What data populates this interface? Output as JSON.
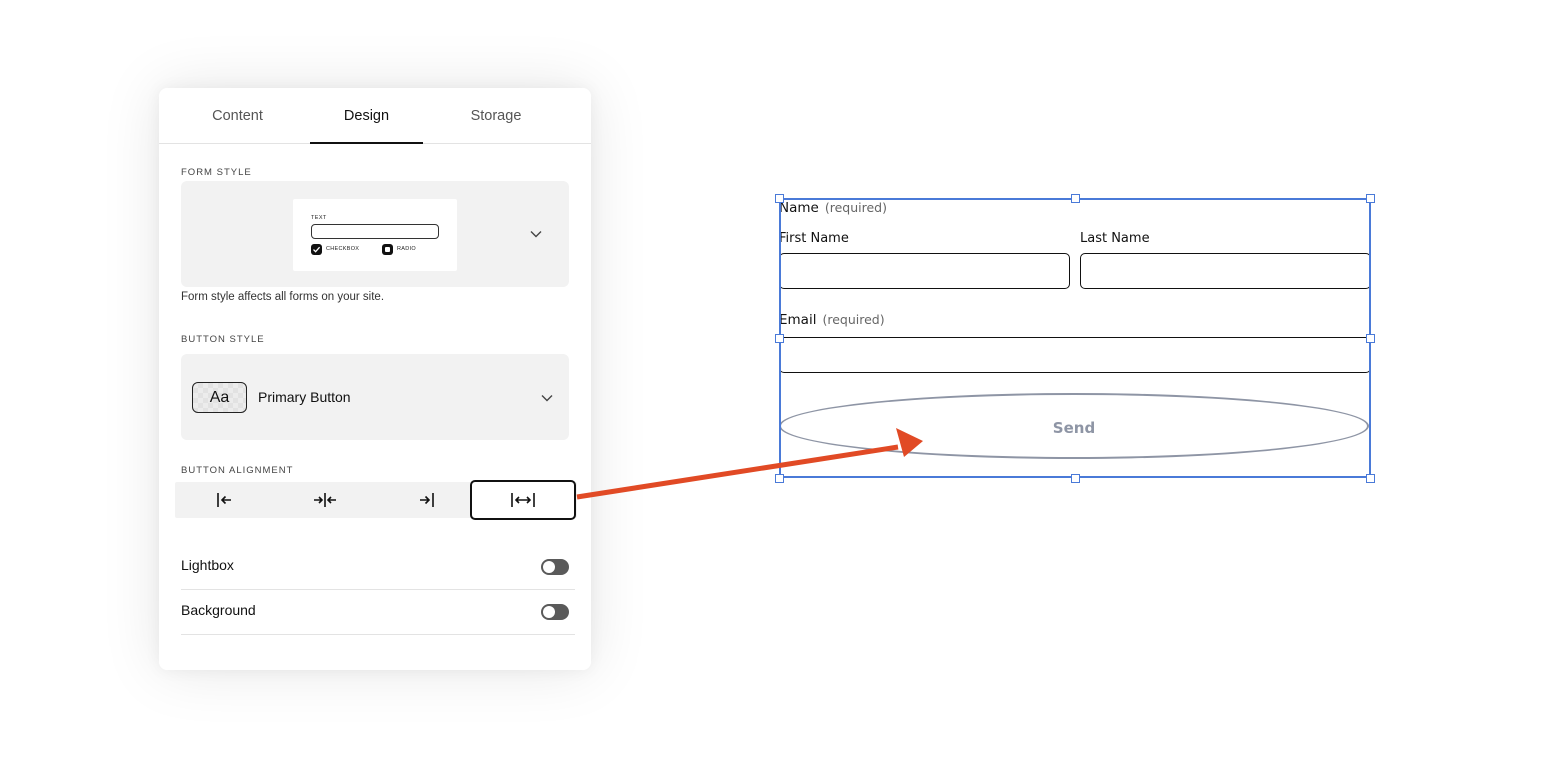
{
  "tabs": [
    {
      "label": "Content",
      "active": false
    },
    {
      "label": "Design",
      "active": true
    },
    {
      "label": "Storage",
      "active": false
    }
  ],
  "form_style": {
    "section_label": "FORM STYLE",
    "preview": {
      "text_label": "TEXT",
      "checkbox_label": "CHECKBOX",
      "radio_label": "RADIO"
    },
    "helper": "Form style affects all forms on your site."
  },
  "button_style": {
    "section_label": "BUTTON STYLE",
    "swatch_text": "Aa",
    "value": "Primary Button"
  },
  "button_alignment": {
    "section_label": "BUTTON ALIGNMENT",
    "options": [
      "left",
      "center",
      "right",
      "full-width"
    ],
    "selected": "full-width"
  },
  "toggles": [
    {
      "label": "Lightbox",
      "on": false
    },
    {
      "label": "Background",
      "on": false
    }
  ],
  "form_preview": {
    "name_label": "Name",
    "name_required": "(required)",
    "first_name_label": "First Name",
    "last_name_label": "Last Name",
    "email_label": "Email",
    "email_required": "(required)",
    "submit_label": "Send"
  },
  "colors": {
    "selection": "#4a7ad8",
    "arrow": "#e14a25",
    "send_button": "#8e95a5"
  }
}
